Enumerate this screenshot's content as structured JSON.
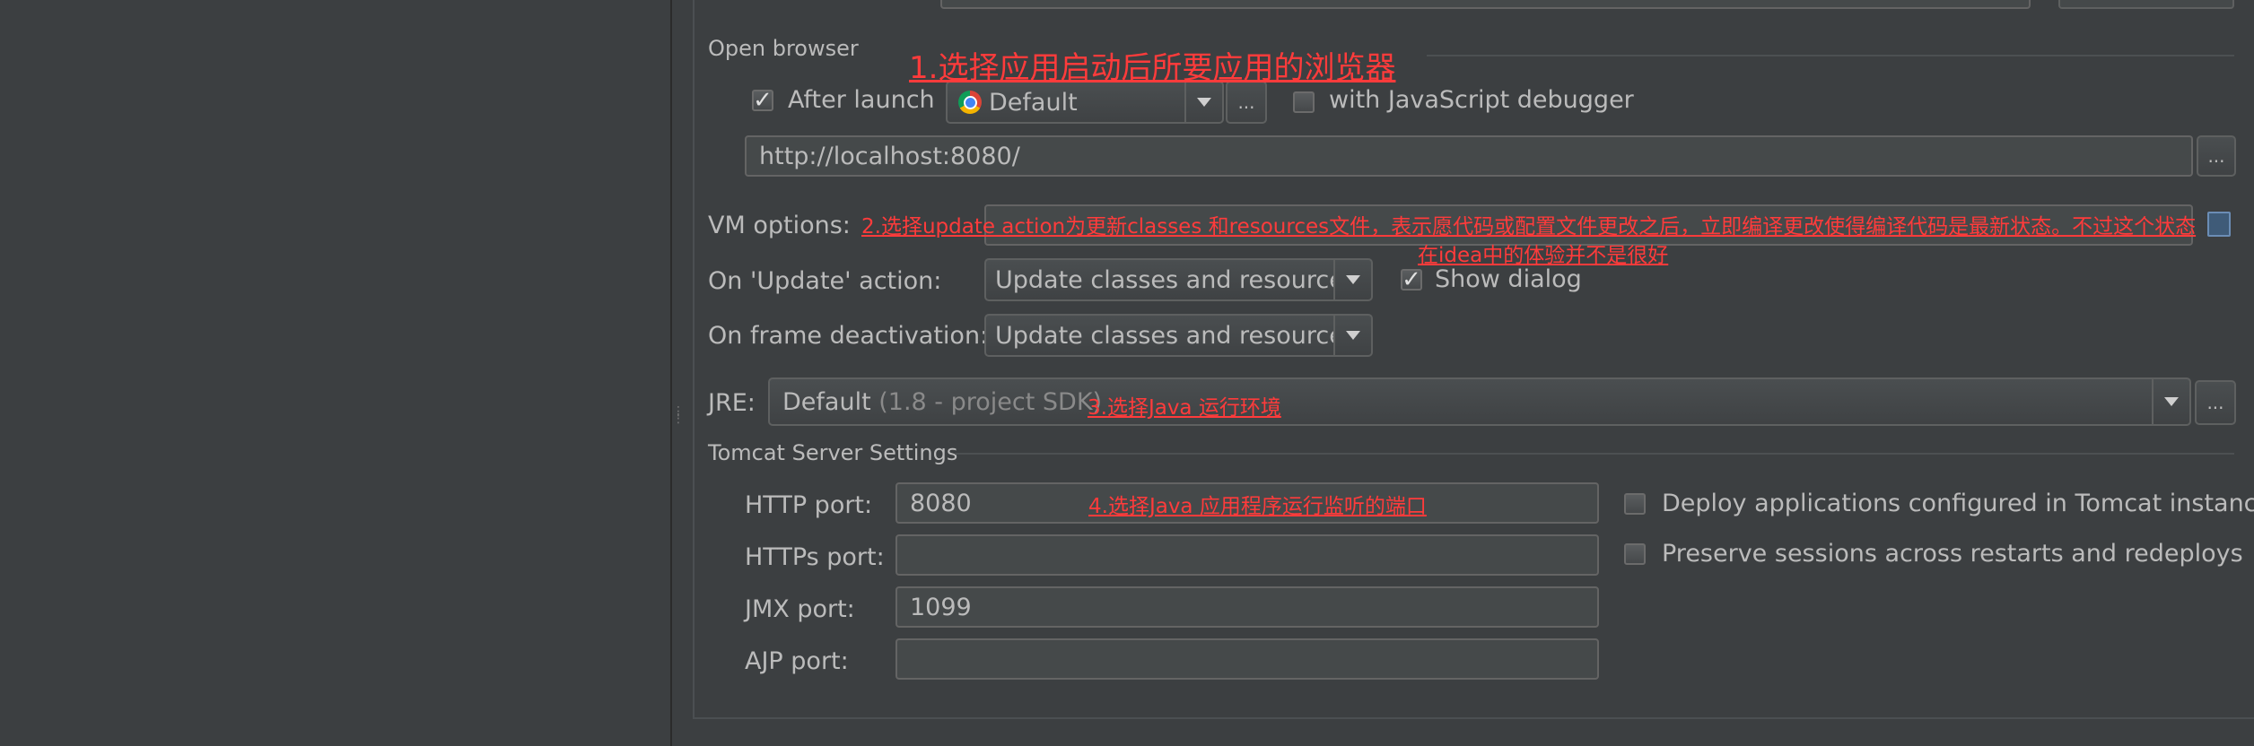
{
  "open_browser": {
    "section_title": "Open browser",
    "after_launch_label": "After launch",
    "after_launch_checked": true,
    "browser_value": "Default",
    "browser_icon": "chrome-icon",
    "js_debugger_label": "with JavaScript debugger",
    "js_debugger_checked": false,
    "url_value": "http://localhost:8080/",
    "dots_label": "..."
  },
  "vm_options": {
    "label": "VM options:",
    "value": ""
  },
  "update_action": {
    "label": "On 'Update' action:",
    "value": "Update classes and resources",
    "show_dialog_label": "Show dialog",
    "show_dialog_checked": true
  },
  "frame_deactivation": {
    "label": "On frame deactivation:",
    "value": "Update classes and resources"
  },
  "jre": {
    "label": "JRE:",
    "value": "Default",
    "value_hint": "(1.8 - project SDK)",
    "dots_label": "..."
  },
  "tomcat": {
    "section_title": "Tomcat Server Settings",
    "http_port_label": "HTTP port:",
    "http_port_value": "8080",
    "https_port_label": "HTTPs port:",
    "https_port_value": "",
    "jmx_port_label": "JMX port:",
    "jmx_port_value": "1099",
    "ajp_port_label": "AJP port:",
    "ajp_port_value": "",
    "deploy_label": "Deploy applications configured in Tomcat instance",
    "deploy_checked": false,
    "preserve_label": "Preserve sessions across restarts and redeploys",
    "preserve_checked": false
  },
  "annotations": {
    "note1": "1.选择应用启动后所要应用的浏览器",
    "note2_line1": "2.选择update action为更新classes 和resources文件，表示愿代码或配置文件更改之后，立即编译更改使得编译代码是最新状态。不过这个状态",
    "note2_line2": "在idea中的体验并不是很好",
    "note3": "3.选择Java 运行环境",
    "note4": "4.选择Java 应用程序运行监听的端口"
  },
  "colors": {
    "background": "#3c3f41",
    "field_background": "#45494a",
    "text": "#bbbbbb",
    "annotation": "#ff3b3b"
  }
}
